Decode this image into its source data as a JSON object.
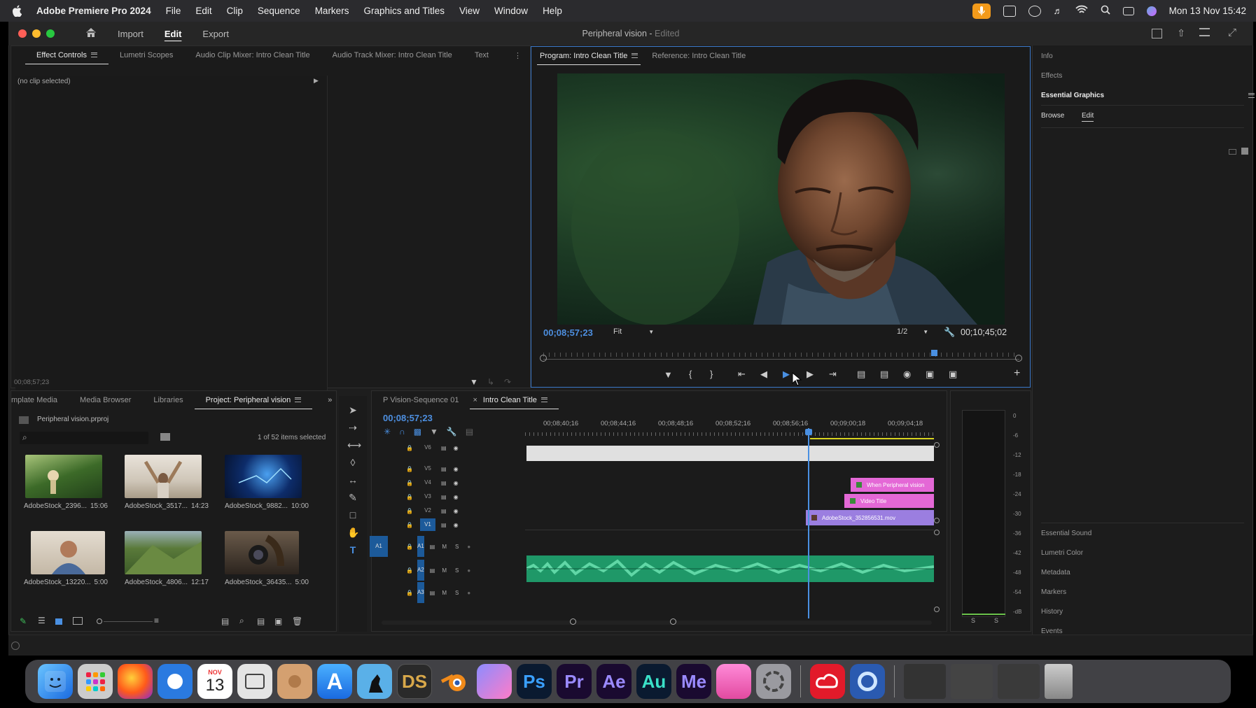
{
  "menubar": {
    "app_name": "Adobe Premiere Pro 2024",
    "items": [
      "File",
      "Edit",
      "Clip",
      "Sequence",
      "Markers",
      "Graphics and Titles",
      "View",
      "Window",
      "Help"
    ],
    "datetime": "Mon 13 Nov  15:42"
  },
  "header": {
    "import": "Import",
    "edit": "Edit",
    "export": "Export",
    "project_title": "Peripheral vision",
    "edited": "Edited"
  },
  "source_panel": {
    "tabs": [
      "Effect Controls",
      "Lumetri Scopes",
      "Audio Clip Mixer: Intro Clean Title",
      "Audio Track Mixer: Intro Clean Title",
      "Text"
    ],
    "no_clip": "(no clip selected)",
    "timecode": "00;08;57;23"
  },
  "program_monitor": {
    "tab_program": "Program: Intro Clean Title",
    "tab_reference": "Reference: Intro Clean Title",
    "timecode": "00;08;57;23",
    "fit": "Fit",
    "resolution": "1/2",
    "duration": "00;10;45;02",
    "playhead_fraction": 0.82
  },
  "right_panel": {
    "top_items": [
      "Info",
      "Effects",
      "Essential Graphics"
    ],
    "browse": "Browse",
    "edit": "Edit",
    "bottom_items": [
      "Essential Sound",
      "Lumetri Color",
      "Metadata",
      "Markers",
      "History",
      "Events"
    ]
  },
  "project_panel": {
    "tabs": [
      "mplate Media",
      "Media Browser",
      "Libraries",
      "Project: Peripheral vision"
    ],
    "file": "Peripheral vision.prproj",
    "selected": "1 of 52 items selected",
    "items": [
      {
        "name": "AdobeStock_2396...",
        "dur": "15:06"
      },
      {
        "name": "AdobeStock_3517...",
        "dur": "14:23"
      },
      {
        "name": "AdobeStock_9882...",
        "dur": "10:00"
      },
      {
        "name": "AdobeStock_13220...",
        "dur": "5:00"
      },
      {
        "name": "AdobeStock_4806...",
        "dur": "12:17"
      },
      {
        "name": "AdobeStock_36435...",
        "dur": "5:00"
      }
    ]
  },
  "timeline": {
    "tab_sequence": "P Vision-Sequence 01",
    "tab_active": "Intro Clean Title",
    "timecode": "00;08;57;23",
    "ruler": [
      "00;08;40;16",
      "00;08;44;16",
      "00;08;48;16",
      "00;08;52;16",
      "00;08;56;16",
      "00;09;00;18",
      "00;09;04;18"
    ],
    "video_tracks": [
      "V6",
      "V5",
      "V4",
      "V3",
      "V2",
      "V1"
    ],
    "audio_tracks": [
      "A1",
      "A2",
      "A3"
    ],
    "clip_when": "When Peripheral vision",
    "clip_video_title": "Video Title",
    "clip_v1": "AdobeStock_352856531.mov",
    "track_letters": {
      "m": "M",
      "s": "S"
    }
  },
  "meter": {
    "labels": [
      "0",
      "-6",
      "-12",
      "-18",
      "-24",
      "-30",
      "-36",
      "-42",
      "-48",
      "-54",
      "-dB"
    ],
    "s": "S"
  },
  "dock": {
    "calendar_month": "NOV",
    "calendar_day": "13",
    "apps": [
      "Ps",
      "Pr",
      "Ae",
      "Au",
      "Me"
    ],
    "ds": "DS"
  },
  "colors": {
    "accent": "#4d8fe0",
    "clip_pink": "#e468d6",
    "clip_purple": "#9b7ee0",
    "audio_green": "#35c98a",
    "playhead": "#4a90e2"
  }
}
